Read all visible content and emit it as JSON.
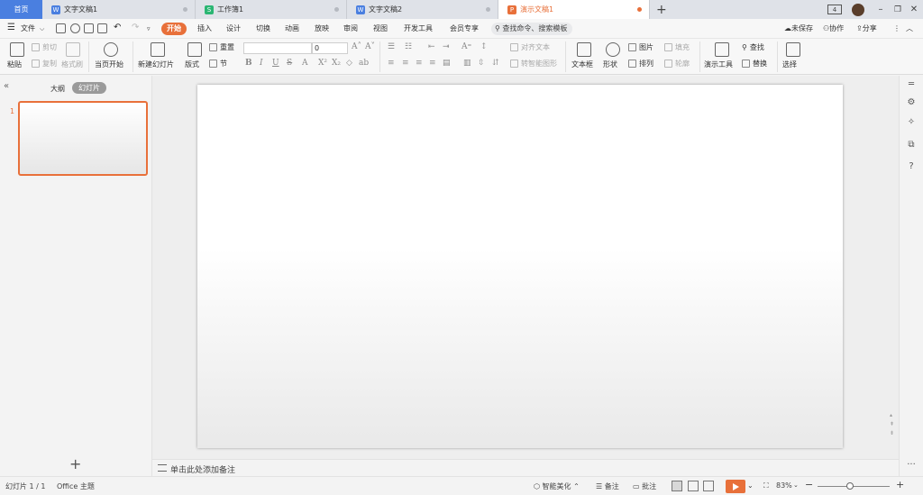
{
  "tabs": {
    "home": "首页",
    "items": [
      {
        "label": "文字文稿1",
        "badge": "W",
        "color": "#4a7fe0"
      },
      {
        "label": "工作簿1",
        "badge": "S",
        "color": "#2bb673"
      },
      {
        "label": "文字文稿2",
        "badge": "W",
        "color": "#4a7fe0"
      },
      {
        "label": "演示文稿1",
        "badge": "P",
        "color": "#e8703a"
      }
    ],
    "add": "+",
    "window_count": "4"
  },
  "menu": {
    "file": "文件",
    "items": [
      "开始",
      "插入",
      "设计",
      "切换",
      "动画",
      "放映",
      "审阅",
      "视图",
      "开发工具",
      "会员专享"
    ],
    "search": "查找命令、搜索模板",
    "unsaved": "未保存",
    "collab": "协作",
    "share": "分享"
  },
  "ribbon": {
    "paste": "粘贴",
    "cut": "剪切",
    "copy": "复制",
    "format_painter": "格式刷",
    "play_from_start": "当页开始",
    "new_slide": "新建幻灯片",
    "layout": "版式",
    "reset": "重置",
    "section": "节",
    "font_size": "0",
    "align_text": "对齐文本",
    "smartart": "转智能图形",
    "textbox": "文本框",
    "shape": "形状",
    "picture": "图片",
    "arrange": "排列",
    "fill": "填充",
    "outline": "轮廓",
    "presenter_tools": "演示工具",
    "find": "查找",
    "replace": "替换",
    "select": "选择"
  },
  "left_panel": {
    "collapse": "«",
    "outline_tab": "大纲",
    "slides_tab": "幻灯片",
    "slide_number": "1",
    "add": "+"
  },
  "notes": {
    "placeholder": "单击此处添加备注"
  },
  "status": {
    "slide_info": "幻灯片 1 / 1",
    "theme": "Office 主题",
    "beautify": "智能美化",
    "notes": "备注",
    "comments": "批注",
    "zoom": "83%",
    "zoom_fraction": 0.45
  }
}
